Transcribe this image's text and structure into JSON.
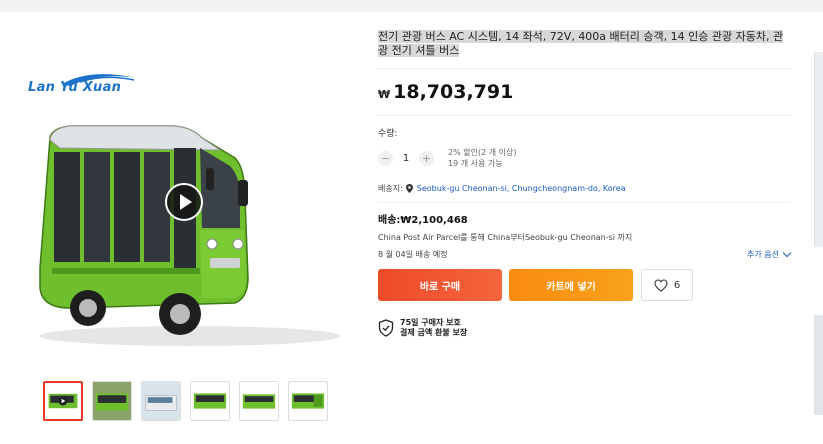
{
  "product": {
    "title": "전기 관광 버스 AC 시스템, 14 좌석, 72V, 400a 배터리 승객, 14 인승 관광 자동차, 관광 전기 셔틀 버스",
    "currency_symbol": "₩",
    "price": "18,703,791"
  },
  "gallery": {
    "logo_text": "Lan Yu Xuan",
    "thumbnail_count": 6
  },
  "quantity": {
    "label": "수량:",
    "minus": "−",
    "value": "1",
    "plus": "+",
    "discount_line1": "2% 할인(2 개 이상)",
    "discount_line2": "19 개 사용 가능"
  },
  "shipping": {
    "ship_to_label": "배송지:",
    "ship_to_location": "Seobuk-gu Cheonan-si, Chungcheongnam-do, Korea",
    "fee": "배송:₩2,100,468",
    "method": "China Post Air Parcel를 통해 China부터Seobuk-gu Cheonan-si 까지",
    "delivery_date": "8 월 04일 배송 예정",
    "more_options": "추가 옵션"
  },
  "actions": {
    "buy_now": "바로 구매",
    "add_to_cart": "카트에 넣기",
    "wishlist_count": "6"
  },
  "protection": {
    "line1": "75일 구매자 보호",
    "line2": "결제 금액 환불 보장"
  },
  "colors": {
    "buy_button": "#ee4a2a",
    "cart_button": "#fa8b12",
    "link": "#1a5bbd",
    "bus_green": "#6fbe2e"
  }
}
